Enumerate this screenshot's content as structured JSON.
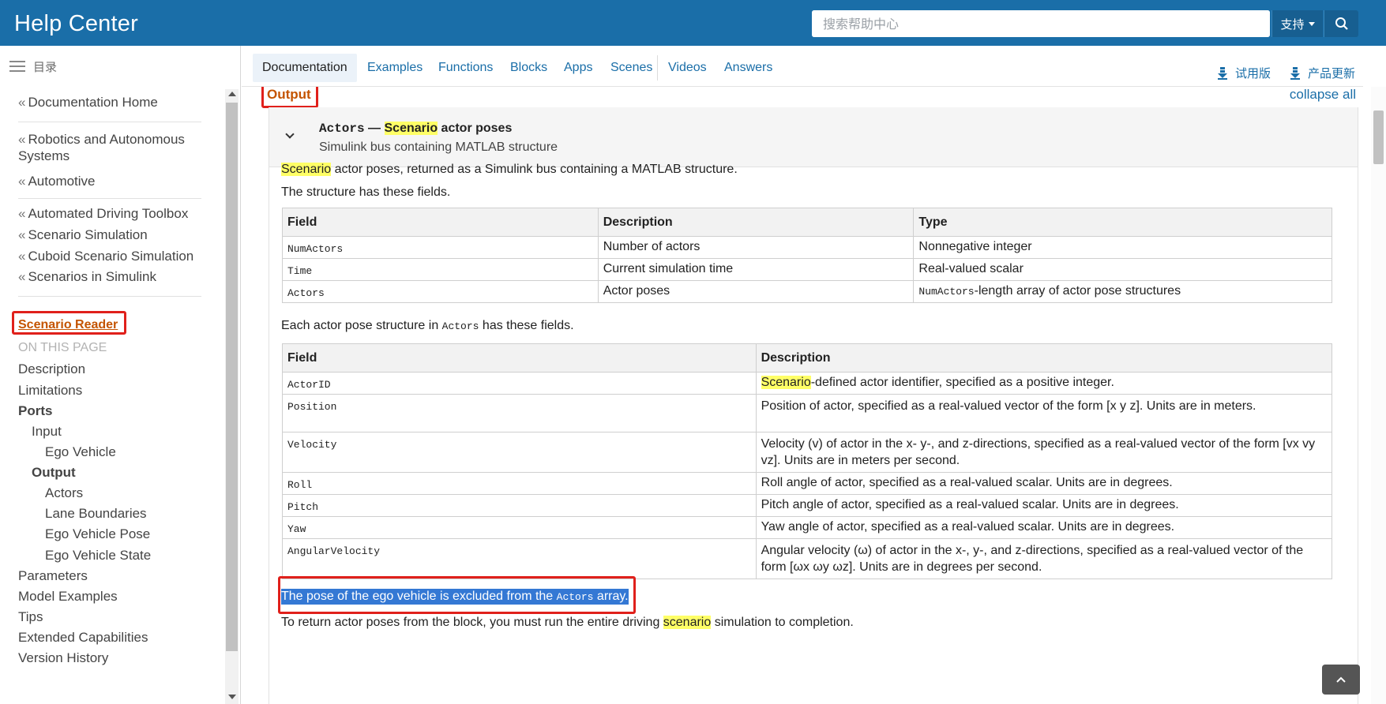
{
  "header": {
    "brand": "Help Center",
    "search_placeholder": "搜索帮助中心",
    "support_label": "支持"
  },
  "sidebar": {
    "toc_label": "目录",
    "breadcrumbs": [
      "Documentation Home",
      "Robotics and Autonomous Systems",
      "Automotive",
      "Automated Driving Toolbox",
      "Scenario Simulation",
      "Cuboid Scenario Simulation",
      "Scenarios in Simulink"
    ],
    "current_page": "Scenario Reader",
    "on_this_page": "ON THIS PAGE",
    "toc": [
      "Description",
      "Limitations",
      "Ports",
      "Input",
      "Ego Vehicle",
      "Output",
      "Actors",
      "Lane Boundaries",
      "Ego Vehicle Pose",
      "Ego Vehicle State",
      "Parameters",
      "Model Examples",
      "Tips",
      "Extended Capabilities",
      "Version History"
    ]
  },
  "tabs": {
    "items": [
      "Documentation",
      "Examples",
      "Functions",
      "Blocks",
      "Apps",
      "Scenes",
      "Videos",
      "Answers"
    ],
    "trial_label": "试用版",
    "updates_label": "产品更新"
  },
  "main": {
    "section_label": "Output",
    "collapse_all": "collapse all",
    "port_name": "Actors",
    "port_dash": " — ",
    "port_title_hl": "Scenario",
    "port_title_rest": " actor poses",
    "port_subtitle": "Simulink bus containing MATLAB structure",
    "intro_hl": "Scenario",
    "intro_rest": " actor poses, returned as a Simulink bus containing a MATLAB structure.",
    "fields_intro": "The structure has these fields.",
    "table1": {
      "headers": [
        "Field",
        "Description",
        "Type"
      ],
      "rows": [
        [
          "NumActors",
          "Number of actors",
          "Nonnegative integer"
        ],
        [
          "Time",
          "Current simulation time",
          "Real-valued scalar"
        ],
        [
          "Actors",
          "Actor poses",
          "-length array of actor pose structures"
        ]
      ],
      "row3_type_code": "NumActors"
    },
    "each_pre": "Each actor pose structure in ",
    "each_code": "Actors",
    "each_post": " has these fields.",
    "table2": {
      "headers": [
        "Field",
        "Description"
      ],
      "rows": [
        [
          "ActorID",
          "-defined actor identifier, specified as a positive integer."
        ],
        [
          "Position",
          "Position of actor, specified as a real-valued vector of the form [x y z]. Units are in meters."
        ],
        [
          "Velocity",
          "Velocity (v) of actor in the x- y-, and z-directions, specified as a real-valued vector of the form [vx vy vz]. Units are in meters per second."
        ],
        [
          "Roll",
          "Roll angle of actor, specified as a real-valued scalar. Units are in degrees."
        ],
        [
          "Pitch",
          "Pitch angle of actor, specified as a real-valued scalar. Units are in degrees."
        ],
        [
          "Yaw",
          "Yaw angle of actor, specified as a real-valued scalar. Units are in degrees."
        ],
        [
          "AngularVelocity",
          "Angular velocity (ω) of actor in the x-, y-, and z-directions, specified as a real-valued vector of the form [ωx ωy ωz]. Units are in degrees per second."
        ]
      ],
      "row1_hl": "Scenario"
    },
    "note_pre": "The pose of the ego vehicle is excluded from the ",
    "note_code": "Actors",
    "note_post": " array.",
    "last_pre": "To return actor poses from the block, you must run the entire driving ",
    "last_hl": "scenario",
    "last_post": " simulation to completion."
  }
}
